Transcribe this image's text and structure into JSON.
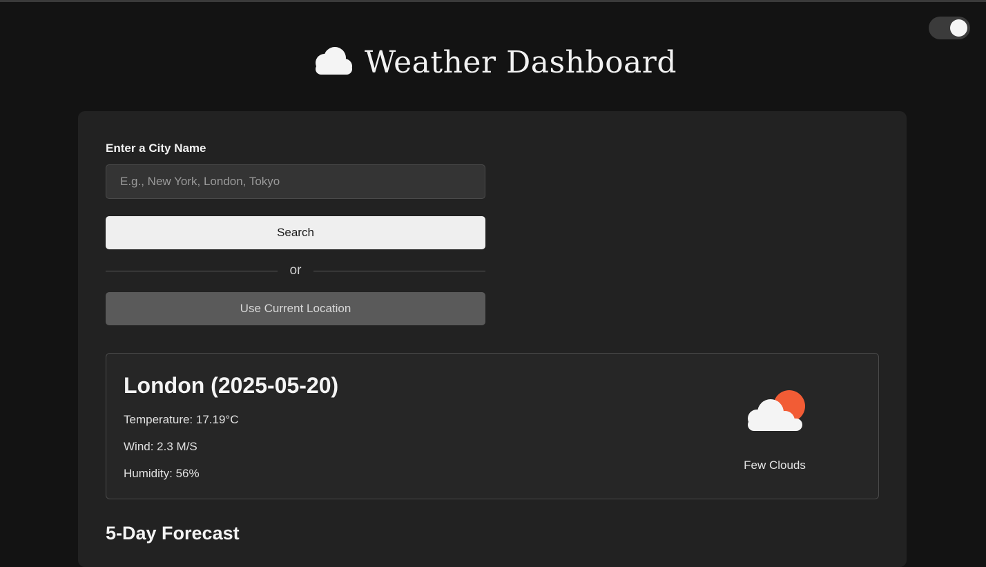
{
  "header": {
    "title": "Weather Dashboard",
    "icon": "cloud-icon"
  },
  "theme_toggle": {
    "state": "on",
    "icon": "toggle-switch"
  },
  "search": {
    "label": "Enter a City Name",
    "placeholder": "E.g., New York, London, Tokyo",
    "value": "",
    "button_label": "Search",
    "divider_text": "or",
    "location_button_label": "Use Current Location"
  },
  "current": {
    "title": "London (2025-05-20)",
    "temperature": "Temperature: 17.19°C",
    "wind": "Wind: 2.3 M/S",
    "humidity": "Humidity: 56%",
    "description": "Few Clouds",
    "icon": "few-clouds-icon"
  },
  "forecast": {
    "title": "5-Day Forecast"
  },
  "colors": {
    "background": "#131313",
    "panel": "#222222",
    "card": "#262626",
    "sun": "#f25c35",
    "button_primary": "#efefef",
    "button_secondary": "#5a5a5a"
  }
}
